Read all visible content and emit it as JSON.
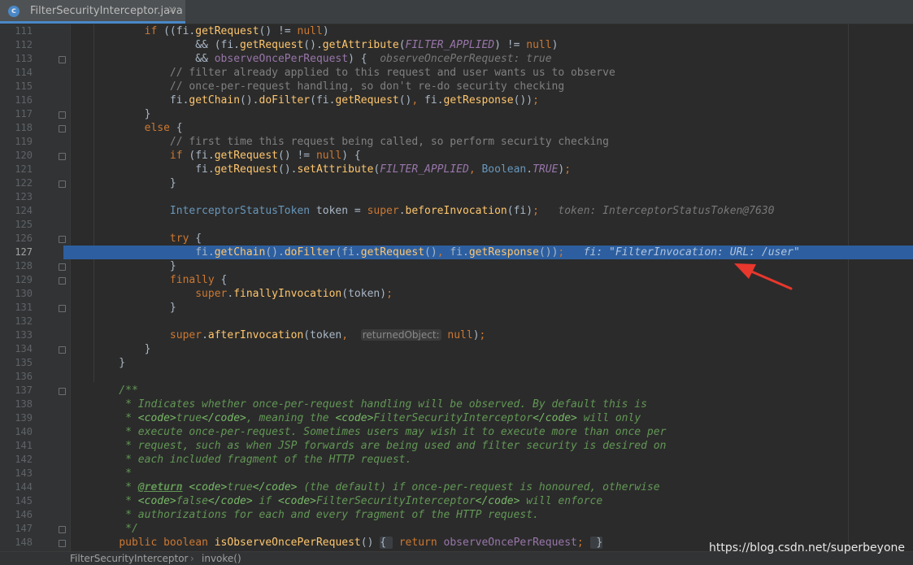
{
  "tab": {
    "icon_letter": "c",
    "filename": "FilterSecurityInterceptor.java",
    "close": "×"
  },
  "lines": [
    {
      "n": "111",
      "t": "        if ((fi.getRequest() != null)"
    },
    {
      "n": "112",
      "t": "                && (fi.getRequest().getAttribute(FILTER_APPLIED) != null)"
    },
    {
      "n": "113",
      "t": "                && observeOncePerRequest) {  observeOncePerRequest: true"
    },
    {
      "n": "114",
      "t": "            // filter already applied to this request and user wants us to observe"
    },
    {
      "n": "115",
      "t": "            // once-per-request handling, so don't re-do security checking"
    },
    {
      "n": "116",
      "t": "            fi.getChain().doFilter(fi.getRequest(), fi.getResponse());"
    },
    {
      "n": "117",
      "t": "        }"
    },
    {
      "n": "118",
      "t": "        else {"
    },
    {
      "n": "119",
      "t": "            // first time this request being called, so perform security checking"
    },
    {
      "n": "120",
      "t": "            if (fi.getRequest() != null) {"
    },
    {
      "n": "121",
      "t": "                fi.getRequest().setAttribute(FILTER_APPLIED, Boolean.TRUE);"
    },
    {
      "n": "122",
      "t": "            }"
    },
    {
      "n": "123",
      "t": ""
    },
    {
      "n": "124",
      "t": "            InterceptorStatusToken token = super.beforeInvocation(fi);   token: InterceptorStatusToken@7630"
    },
    {
      "n": "125",
      "t": ""
    },
    {
      "n": "126",
      "t": "            try {"
    },
    {
      "n": "127",
      "t": "                fi.getChain().doFilter(fi.getRequest(), fi.getResponse());   fi: \"FilterInvocation: URL: /user\""
    },
    {
      "n": "128",
      "t": "            }"
    },
    {
      "n": "129",
      "t": "            finally {"
    },
    {
      "n": "130",
      "t": "                super.finallyInvocation(token);"
    },
    {
      "n": "131",
      "t": "            }"
    },
    {
      "n": "132",
      "t": ""
    },
    {
      "n": "133",
      "t": "            super.afterInvocation(token,  returnedObject: null);"
    },
    {
      "n": "134",
      "t": "        }"
    },
    {
      "n": "135",
      "t": "    }"
    },
    {
      "n": "136",
      "t": ""
    },
    {
      "n": "137",
      "t": "    /**"
    },
    {
      "n": "138",
      "t": "     * Indicates whether once-per-request handling will be observed. By default this is"
    },
    {
      "n": "139",
      "t": "     * <code>true</code>, meaning the <code>FilterSecurityInterceptor</code> will only"
    },
    {
      "n": "140",
      "t": "     * execute once-per-request. Sometimes users may wish it to execute more than once per"
    },
    {
      "n": "141",
      "t": "     * request, such as when JSP forwards are being used and filter security is desired on"
    },
    {
      "n": "142",
      "t": "     * each included fragment of the HTTP request."
    },
    {
      "n": "143",
      "t": "     *"
    },
    {
      "n": "144",
      "t": "     * @return <code>true</code> (the default) if once-per-request is honoured, otherwise"
    },
    {
      "n": "145",
      "t": "     * <code>false</code> if <code>FilterSecurityInterceptor</code> will enforce"
    },
    {
      "n": "146",
      "t": "     * authorizations for each and every fragment of the HTTP request."
    },
    {
      "n": "147",
      "t": "     */"
    },
    {
      "n": "148",
      "t": "    public boolean isObserveOncePerRequest() { return observeOncePerRequest; }"
    }
  ],
  "breadcrumbs": {
    "class": "FilterSecurityInterceptor",
    "separator": "›",
    "method": "invoke()"
  },
  "watermark": "https://blog.csdn.net/superbeyone",
  "colors": {
    "highlight": "#2d5fa0",
    "arrow": "#e8372d",
    "keyword": "#cc7832",
    "method": "#ffc66d",
    "comment": "#808080",
    "javadoc": "#629755"
  }
}
